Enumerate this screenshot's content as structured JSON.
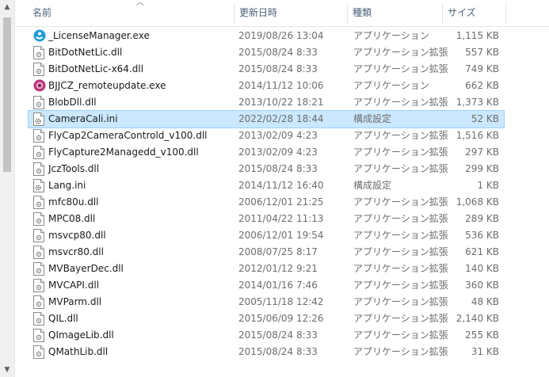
{
  "columns": {
    "name": "名前",
    "date": "更新日時",
    "type": "種類",
    "size": "サイズ"
  },
  "files": [
    {
      "name": "_LicenseManager.exe",
      "date": "2019/08/26 13:04",
      "type": "アプリケーション",
      "size": "1,115 KB",
      "icon": "license-app-icon"
    },
    {
      "name": "BitDotNetLic.dll",
      "date": "2015/08/24 8:33",
      "type": "アプリケーション拡張",
      "size": "557 KB",
      "icon": "dll-file-icon"
    },
    {
      "name": "BitDotNetLic-x64.dll",
      "date": "2015/08/24 8:33",
      "type": "アプリケーション拡張",
      "size": "749 KB",
      "icon": "dll-file-icon"
    },
    {
      "name": "BJJCZ_remoteupdate.exe",
      "date": "2014/11/12 10:06",
      "type": "アプリケーション",
      "size": "662 KB",
      "icon": "update-app-icon"
    },
    {
      "name": "BlobDll.dll",
      "date": "2013/10/22 18:21",
      "type": "アプリケーション拡張",
      "size": "1,373 KB",
      "icon": "dll-file-icon"
    },
    {
      "name": "CameraCali.ini",
      "date": "2022/02/28 18:44",
      "type": "構成設定",
      "size": "52 KB",
      "icon": "ini-file-icon"
    },
    {
      "name": "FlyCap2CameraControld_v100.dll",
      "date": "2013/02/09 4:23",
      "type": "アプリケーション拡張",
      "size": "1,516 KB",
      "icon": "dll-file-icon"
    },
    {
      "name": "FlyCapture2Managedd_v100.dll",
      "date": "2013/02/09 4:23",
      "type": "アプリケーション拡張",
      "size": "297 KB",
      "icon": "dll-file-icon"
    },
    {
      "name": "JczTools.dll",
      "date": "2015/08/24 8:33",
      "type": "アプリケーション拡張",
      "size": "299 KB",
      "icon": "dll-file-icon"
    },
    {
      "name": "Lang.ini",
      "date": "2014/11/12 16:40",
      "type": "構成設定",
      "size": "1 KB",
      "icon": "ini-file-icon"
    },
    {
      "name": "mfc80u.dll",
      "date": "2006/12/01 21:25",
      "type": "アプリケーション拡張",
      "size": "1,068 KB",
      "icon": "dll-file-icon"
    },
    {
      "name": "MPC08.dll",
      "date": "2011/04/22 11:13",
      "type": "アプリケーション拡張",
      "size": "289 KB",
      "icon": "dll-file-icon"
    },
    {
      "name": "msvcp80.dll",
      "date": "2006/12/01 19:54",
      "type": "アプリケーション拡張",
      "size": "536 KB",
      "icon": "dll-file-icon"
    },
    {
      "name": "msvcr80.dll",
      "date": "2008/07/25 8:17",
      "type": "アプリケーション拡張",
      "size": "621 KB",
      "icon": "dll-file-icon"
    },
    {
      "name": "MVBayerDec.dll",
      "date": "2012/01/12 9:21",
      "type": "アプリケーション拡張",
      "size": "140 KB",
      "icon": "dll-file-icon"
    },
    {
      "name": "MVCAPI.dll",
      "date": "2014/01/16 7:46",
      "type": "アプリケーション拡張",
      "size": "360 KB",
      "icon": "dll-file-icon"
    },
    {
      "name": "MVParm.dll",
      "date": "2005/11/18 12:42",
      "type": "アプリケーション拡張",
      "size": "48 KB",
      "icon": "dll-file-icon"
    },
    {
      "name": "QIL.dll",
      "date": "2015/06/09 12:26",
      "type": "アプリケーション拡張",
      "size": "2,140 KB",
      "icon": "dll-file-icon"
    },
    {
      "name": "QImageLib.dll",
      "date": "2015/08/24 8:33",
      "type": "アプリケーション拡張",
      "size": "255 KB",
      "icon": "dll-file-icon"
    },
    {
      "name": "QMathLib.dll",
      "date": "2015/08/24 8:33",
      "type": "アプリケーション拡張",
      "size": "31 KB",
      "icon": "dll-file-icon"
    }
  ],
  "selected_index": 5,
  "colors": {
    "selection_bg": "#cce8ff",
    "selection_border": "#99d1ff",
    "header_text": "#4c607a"
  }
}
